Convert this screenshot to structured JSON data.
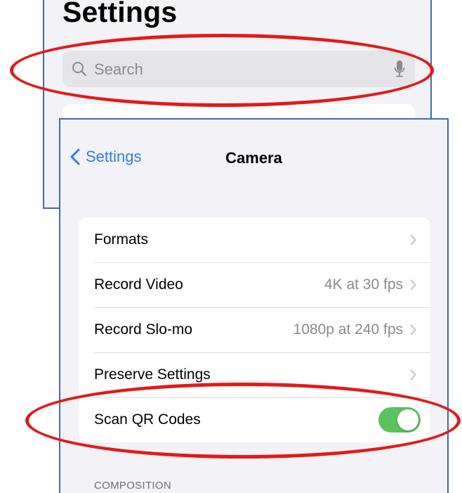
{
  "settings_screen": {
    "title": "Settings",
    "search": {
      "placeholder": "Search"
    }
  },
  "camera_screen": {
    "back_label": "Settings",
    "title": "Camera",
    "rows": [
      {
        "label": "Formats",
        "value": "",
        "control": "chevron"
      },
      {
        "label": "Record Video",
        "value": "4K at 30 fps",
        "control": "chevron"
      },
      {
        "label": "Record Slo-mo",
        "value": "1080p at 240 fps",
        "control": "chevron"
      },
      {
        "label": "Preserve Settings",
        "value": "",
        "control": "chevron"
      },
      {
        "label": "Scan QR Codes",
        "value": "",
        "control": "toggle",
        "toggle_on": true
      }
    ],
    "section_header": "COMPOSITION"
  },
  "colors": {
    "ios_blue": "#2f7cf6",
    "toggle_green": "#5ac35f",
    "highlight_red": "#e21a1a",
    "panel_border": "#3f6bb0"
  },
  "icons": [
    "search-icon",
    "microphone-icon",
    "chevron-left-icon",
    "chevron-right-icon"
  ]
}
